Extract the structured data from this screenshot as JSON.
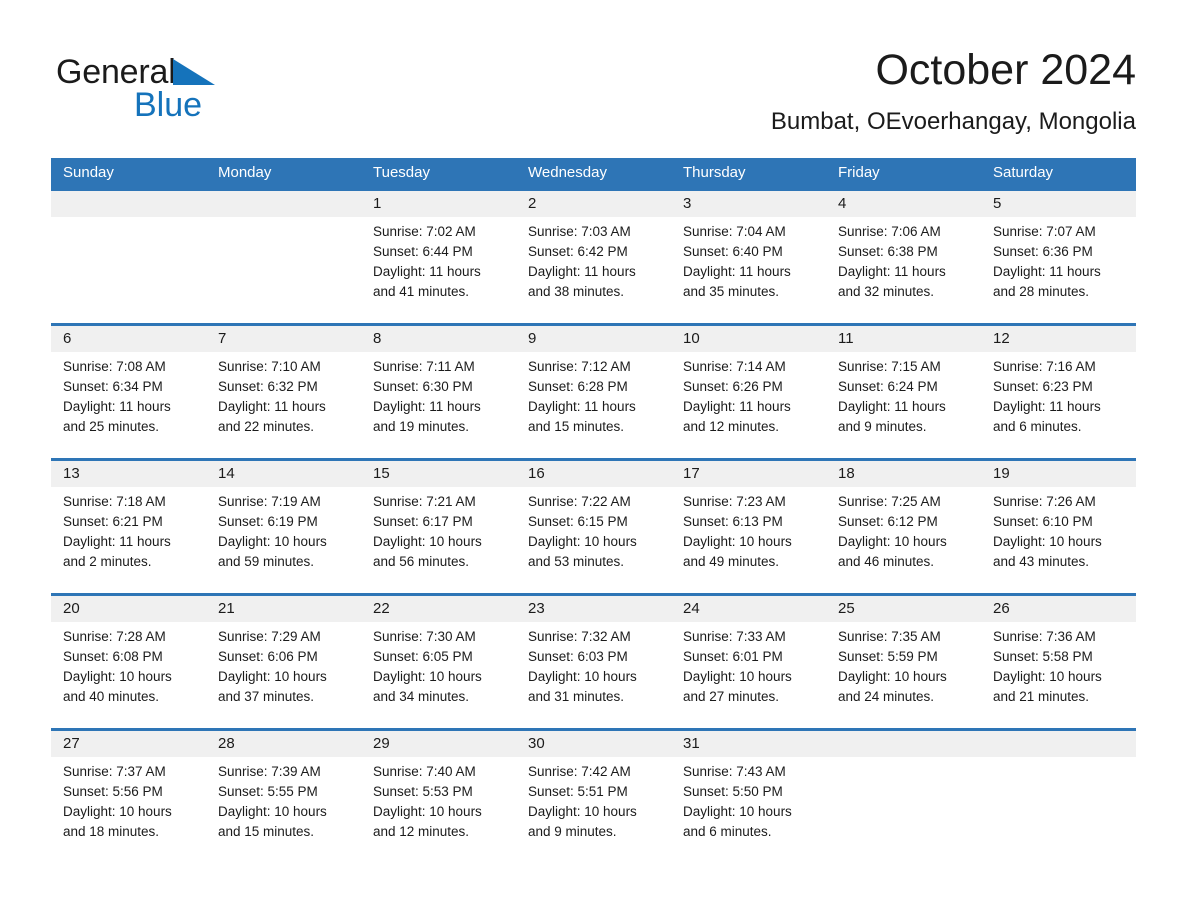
{
  "brand": {
    "name_part1": "General",
    "name_part2": "Blue",
    "triangle_icon": "triangle-icon",
    "accent_color": "#1573bb"
  },
  "header": {
    "title": "October 2024",
    "subtitle": "Bumbat, OEvoerhangay, Mongolia"
  },
  "calendar": {
    "header_bg_color": "#2e75b6",
    "daynum_bg_color": "#f0f0f0",
    "day_names": [
      "Sunday",
      "Monday",
      "Tuesday",
      "Wednesday",
      "Thursday",
      "Friday",
      "Saturday"
    ],
    "weeks": [
      {
        "numbers": [
          "",
          "",
          "1",
          "2",
          "3",
          "4",
          "5"
        ],
        "cells": [
          {
            "sunrise": "",
            "sunset": "",
            "daylight_1": "",
            "daylight_2": ""
          },
          {
            "sunrise": "",
            "sunset": "",
            "daylight_1": "",
            "daylight_2": ""
          },
          {
            "sunrise": "Sunrise: 7:02 AM",
            "sunset": "Sunset: 6:44 PM",
            "daylight_1": "Daylight: 11 hours",
            "daylight_2": "and 41 minutes."
          },
          {
            "sunrise": "Sunrise: 7:03 AM",
            "sunset": "Sunset: 6:42 PM",
            "daylight_1": "Daylight: 11 hours",
            "daylight_2": "and 38 minutes."
          },
          {
            "sunrise": "Sunrise: 7:04 AM",
            "sunset": "Sunset: 6:40 PM",
            "daylight_1": "Daylight: 11 hours",
            "daylight_2": "and 35 minutes."
          },
          {
            "sunrise": "Sunrise: 7:06 AM",
            "sunset": "Sunset: 6:38 PM",
            "daylight_1": "Daylight: 11 hours",
            "daylight_2": "and 32 minutes."
          },
          {
            "sunrise": "Sunrise: 7:07 AM",
            "sunset": "Sunset: 6:36 PM",
            "daylight_1": "Daylight: 11 hours",
            "daylight_2": "and 28 minutes."
          }
        ]
      },
      {
        "numbers": [
          "6",
          "7",
          "8",
          "9",
          "10",
          "11",
          "12"
        ],
        "cells": [
          {
            "sunrise": "Sunrise: 7:08 AM",
            "sunset": "Sunset: 6:34 PM",
            "daylight_1": "Daylight: 11 hours",
            "daylight_2": "and 25 minutes."
          },
          {
            "sunrise": "Sunrise: 7:10 AM",
            "sunset": "Sunset: 6:32 PM",
            "daylight_1": "Daylight: 11 hours",
            "daylight_2": "and 22 minutes."
          },
          {
            "sunrise": "Sunrise: 7:11 AM",
            "sunset": "Sunset: 6:30 PM",
            "daylight_1": "Daylight: 11 hours",
            "daylight_2": "and 19 minutes."
          },
          {
            "sunrise": "Sunrise: 7:12 AM",
            "sunset": "Sunset: 6:28 PM",
            "daylight_1": "Daylight: 11 hours",
            "daylight_2": "and 15 minutes."
          },
          {
            "sunrise": "Sunrise: 7:14 AM",
            "sunset": "Sunset: 6:26 PM",
            "daylight_1": "Daylight: 11 hours",
            "daylight_2": "and 12 minutes."
          },
          {
            "sunrise": "Sunrise: 7:15 AM",
            "sunset": "Sunset: 6:24 PM",
            "daylight_1": "Daylight: 11 hours",
            "daylight_2": "and 9 minutes."
          },
          {
            "sunrise": "Sunrise: 7:16 AM",
            "sunset": "Sunset: 6:23 PM",
            "daylight_1": "Daylight: 11 hours",
            "daylight_2": "and 6 minutes."
          }
        ]
      },
      {
        "numbers": [
          "13",
          "14",
          "15",
          "16",
          "17",
          "18",
          "19"
        ],
        "cells": [
          {
            "sunrise": "Sunrise: 7:18 AM",
            "sunset": "Sunset: 6:21 PM",
            "daylight_1": "Daylight: 11 hours",
            "daylight_2": "and 2 minutes."
          },
          {
            "sunrise": "Sunrise: 7:19 AM",
            "sunset": "Sunset: 6:19 PM",
            "daylight_1": "Daylight: 10 hours",
            "daylight_2": "and 59 minutes."
          },
          {
            "sunrise": "Sunrise: 7:21 AM",
            "sunset": "Sunset: 6:17 PM",
            "daylight_1": "Daylight: 10 hours",
            "daylight_2": "and 56 minutes."
          },
          {
            "sunrise": "Sunrise: 7:22 AM",
            "sunset": "Sunset: 6:15 PM",
            "daylight_1": "Daylight: 10 hours",
            "daylight_2": "and 53 minutes."
          },
          {
            "sunrise": "Sunrise: 7:23 AM",
            "sunset": "Sunset: 6:13 PM",
            "daylight_1": "Daylight: 10 hours",
            "daylight_2": "and 49 minutes."
          },
          {
            "sunrise": "Sunrise: 7:25 AM",
            "sunset": "Sunset: 6:12 PM",
            "daylight_1": "Daylight: 10 hours",
            "daylight_2": "and 46 minutes."
          },
          {
            "sunrise": "Sunrise: 7:26 AM",
            "sunset": "Sunset: 6:10 PM",
            "daylight_1": "Daylight: 10 hours",
            "daylight_2": "and 43 minutes."
          }
        ]
      },
      {
        "numbers": [
          "20",
          "21",
          "22",
          "23",
          "24",
          "25",
          "26"
        ],
        "cells": [
          {
            "sunrise": "Sunrise: 7:28 AM",
            "sunset": "Sunset: 6:08 PM",
            "daylight_1": "Daylight: 10 hours",
            "daylight_2": "and 40 minutes."
          },
          {
            "sunrise": "Sunrise: 7:29 AM",
            "sunset": "Sunset: 6:06 PM",
            "daylight_1": "Daylight: 10 hours",
            "daylight_2": "and 37 minutes."
          },
          {
            "sunrise": "Sunrise: 7:30 AM",
            "sunset": "Sunset: 6:05 PM",
            "daylight_1": "Daylight: 10 hours",
            "daylight_2": "and 34 minutes."
          },
          {
            "sunrise": "Sunrise: 7:32 AM",
            "sunset": "Sunset: 6:03 PM",
            "daylight_1": "Daylight: 10 hours",
            "daylight_2": "and 31 minutes."
          },
          {
            "sunrise": "Sunrise: 7:33 AM",
            "sunset": "Sunset: 6:01 PM",
            "daylight_1": "Daylight: 10 hours",
            "daylight_2": "and 27 minutes."
          },
          {
            "sunrise": "Sunrise: 7:35 AM",
            "sunset": "Sunset: 5:59 PM",
            "daylight_1": "Daylight: 10 hours",
            "daylight_2": "and 24 minutes."
          },
          {
            "sunrise": "Sunrise: 7:36 AM",
            "sunset": "Sunset: 5:58 PM",
            "daylight_1": "Daylight: 10 hours",
            "daylight_2": "and 21 minutes."
          }
        ]
      },
      {
        "numbers": [
          "27",
          "28",
          "29",
          "30",
          "31",
          "",
          ""
        ],
        "cells": [
          {
            "sunrise": "Sunrise: 7:37 AM",
            "sunset": "Sunset: 5:56 PM",
            "daylight_1": "Daylight: 10 hours",
            "daylight_2": "and 18 minutes."
          },
          {
            "sunrise": "Sunrise: 7:39 AM",
            "sunset": "Sunset: 5:55 PM",
            "daylight_1": "Daylight: 10 hours",
            "daylight_2": "and 15 minutes."
          },
          {
            "sunrise": "Sunrise: 7:40 AM",
            "sunset": "Sunset: 5:53 PM",
            "daylight_1": "Daylight: 10 hours",
            "daylight_2": "and 12 minutes."
          },
          {
            "sunrise": "Sunrise: 7:42 AM",
            "sunset": "Sunset: 5:51 PM",
            "daylight_1": "Daylight: 10 hours",
            "daylight_2": "and 9 minutes."
          },
          {
            "sunrise": "Sunrise: 7:43 AM",
            "sunset": "Sunset: 5:50 PM",
            "daylight_1": "Daylight: 10 hours",
            "daylight_2": "and 6 minutes."
          },
          {
            "sunrise": "",
            "sunset": "",
            "daylight_1": "",
            "daylight_2": ""
          },
          {
            "sunrise": "",
            "sunset": "",
            "daylight_1": "",
            "daylight_2": ""
          }
        ]
      }
    ]
  }
}
